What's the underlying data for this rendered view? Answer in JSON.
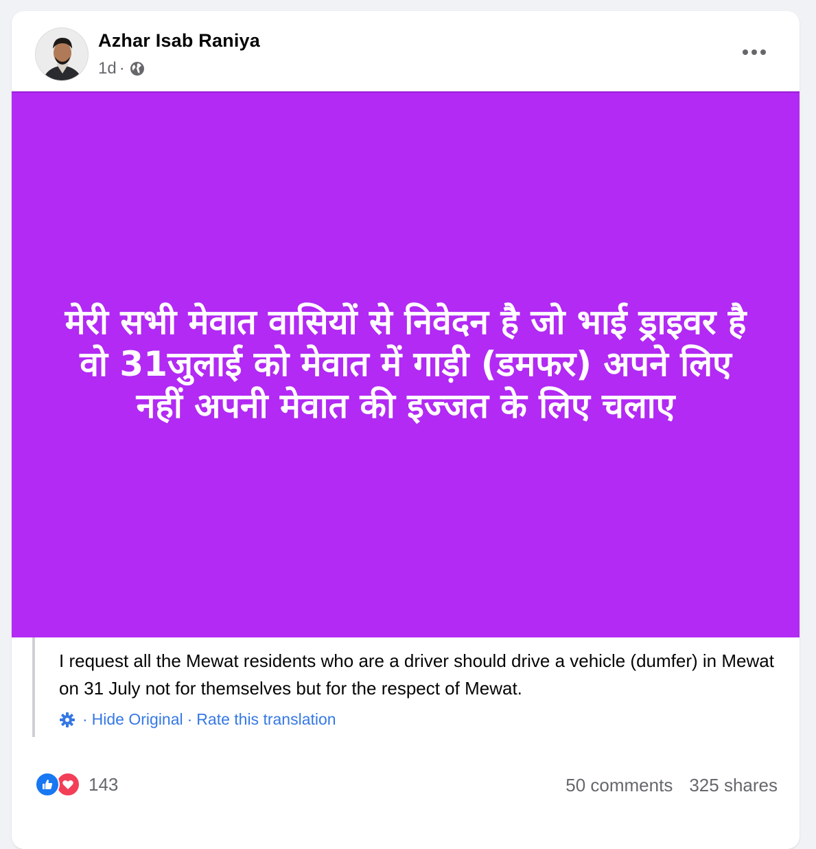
{
  "post": {
    "author": "Azhar Isab Raniya",
    "time": "1d",
    "separator": "·",
    "privacy_icon": "globe-icon",
    "more_icon": "more-horizontal-icon",
    "banner": {
      "background": "#b22af3",
      "text": "मेरी सभी मेवात वासियों से निवेदन है जो भाई ड्राइवर है वो 31जुलाई को मेवात में गाड़ी (डमफर) अपने लिए नहीं अपनी मेवात की इज्जत के लिए चलाए"
    },
    "translation": {
      "text": "I request all the Mewat residents who are a driver should drive a vehicle (dumfer) in Mewat on 31 July not for themselves but for the respect of Mewat.",
      "settings_icon": "gear-icon",
      "sep1": "·",
      "hide_original": "Hide Original",
      "sep2": "·",
      "rate": "Rate this translation"
    },
    "stats": {
      "reaction_icons": [
        "like-icon",
        "love-icon"
      ],
      "reaction_count": "143",
      "comments": "50 comments",
      "shares": "325 shares"
    }
  },
  "colors": {
    "banner": "#b22af3",
    "link": "#3578e5",
    "secondary_text": "#65676b",
    "like": "#1877f2",
    "love": "#f33e58"
  }
}
